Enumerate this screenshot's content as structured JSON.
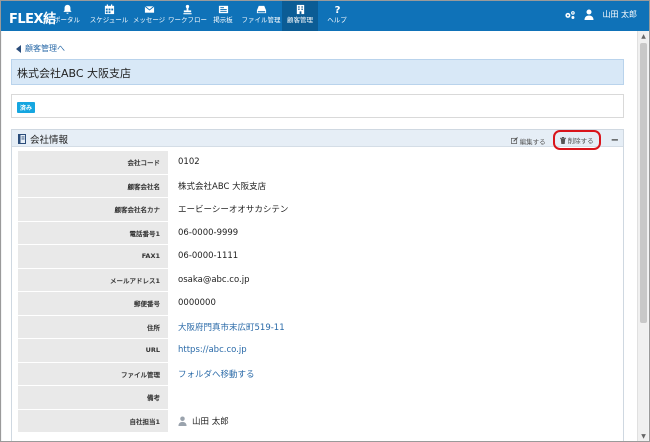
{
  "app": {
    "brand": "FLEX結"
  },
  "nav": {
    "items": [
      {
        "label": "ポータル",
        "icon": "bell-icon"
      },
      {
        "label": "スケジュール",
        "icon": "calendar-icon"
      },
      {
        "label": "メッセージ",
        "icon": "envelope-icon"
      },
      {
        "label": "ワークフロー",
        "icon": "stamp-icon"
      },
      {
        "label": "掲示板",
        "icon": "board-icon"
      },
      {
        "label": "ファイル管理",
        "icon": "drive-icon"
      },
      {
        "label": "顧客管理",
        "icon": "building-icon"
      },
      {
        "label": "ヘルプ",
        "icon": "help-icon"
      }
    ],
    "active_index": 6,
    "user_name": "山田 太郎"
  },
  "breadcrumb": {
    "back_label": "顧客管理へ"
  },
  "page": {
    "title": "株式会社ABC  大阪支店"
  },
  "status": {
    "badge": "済み"
  },
  "panel": {
    "title": "会社情報",
    "edit_label": "編集する",
    "delete_label": "削除する",
    "collapse_label": "−"
  },
  "fields": [
    {
      "label": "会社コード",
      "value": "0102",
      "link": false
    },
    {
      "label": "顧客会社名",
      "value": "株式会社ABC  大阪支店",
      "link": false
    },
    {
      "label": "顧客会社名カナ",
      "value": "エービーシーオオサカシテン",
      "link": false
    },
    {
      "label": "電話番号1",
      "value": "06-0000-9999",
      "link": false
    },
    {
      "label": "FAX1",
      "value": "06-0000-1111",
      "link": false
    },
    {
      "label": "メールアドレス1",
      "value": "osaka@abc.co.jp",
      "link": false
    },
    {
      "label": "郵便番号",
      "value": "0000000",
      "link": false
    },
    {
      "label": "住所",
      "value": "大阪府門真市末広町519-11",
      "link": true
    },
    {
      "label": "URL",
      "value": "https://abc.co.jp",
      "link": true
    },
    {
      "label": "ファイル管理",
      "value": "フォルダへ移動する",
      "link": true
    },
    {
      "label": "備考",
      "value": "",
      "link": false
    },
    {
      "label": "自社担当1",
      "value": "山田 太郎",
      "link": false,
      "avatar": true
    }
  ]
}
